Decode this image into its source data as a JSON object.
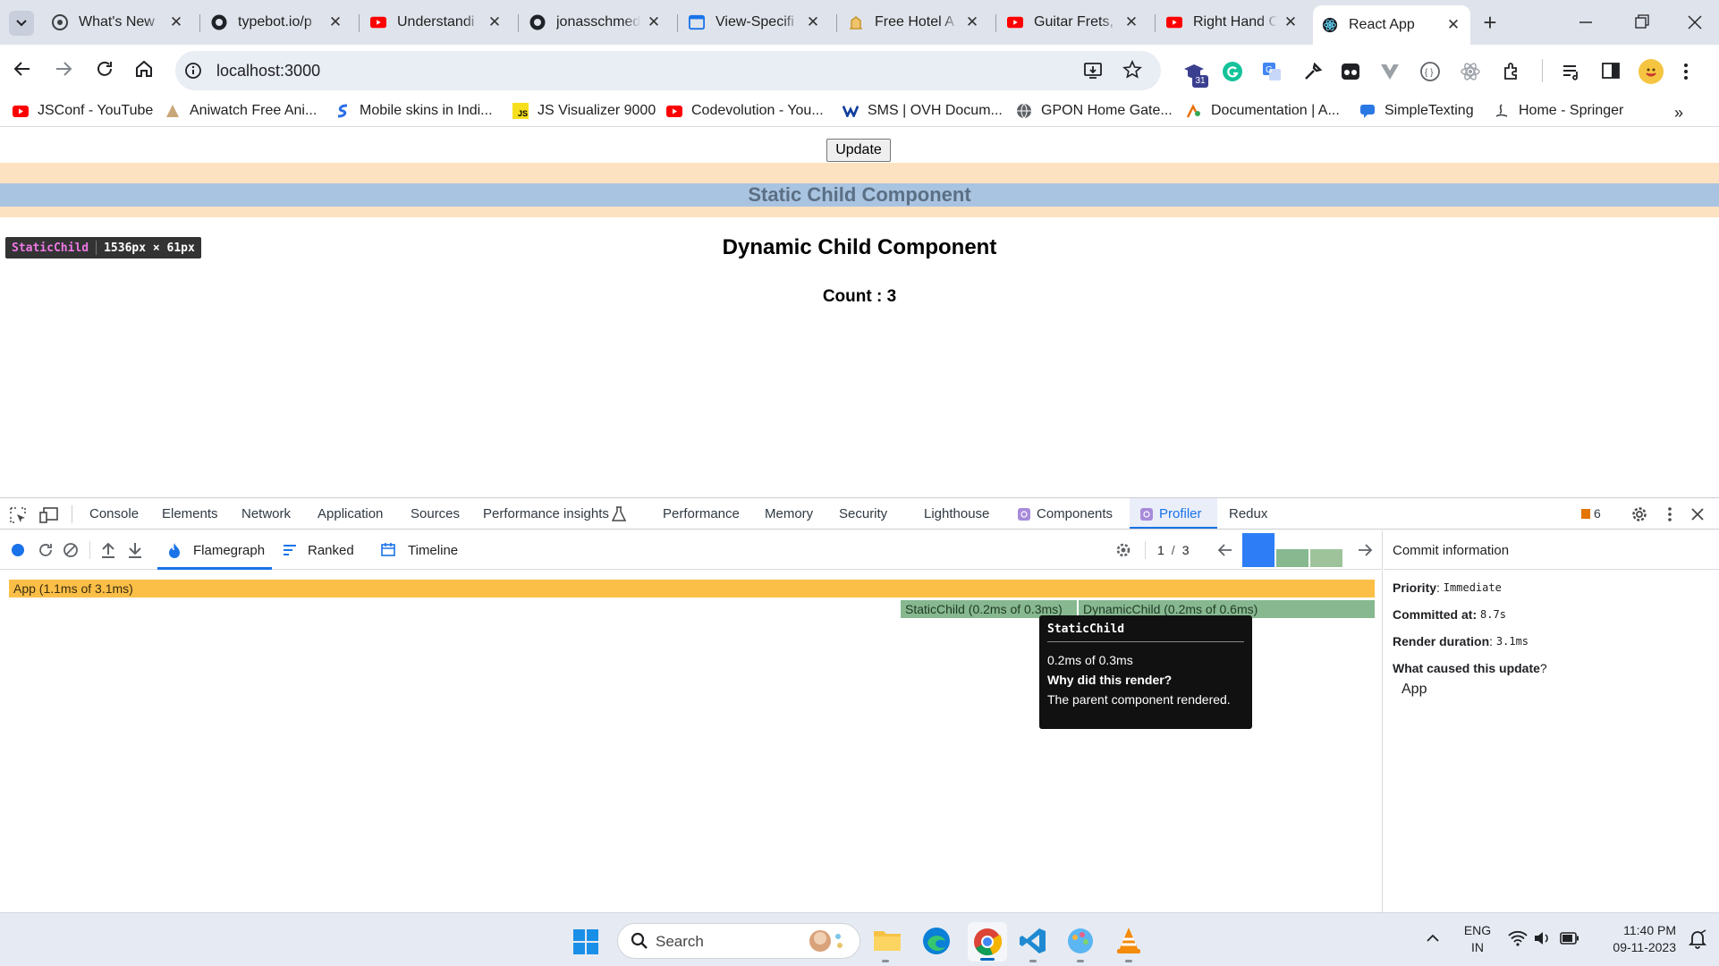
{
  "tabs": [
    {
      "title": "What's New",
      "icon": "chrome-icon"
    },
    {
      "title": "typebot.io/p",
      "icon": "github-icon"
    },
    {
      "title": "Understandi",
      "icon": "youtube-icon"
    },
    {
      "title": "jonasschmed",
      "icon": "github-icon"
    },
    {
      "title": "View-Specifi",
      "icon": "window-icon"
    },
    {
      "title": "Free Hotel A",
      "icon": "hotel-icon"
    },
    {
      "title": "Guitar Frets,",
      "icon": "youtube-icon"
    },
    {
      "title": "Right Hand C",
      "icon": "youtube-icon"
    },
    {
      "title": "React App",
      "icon": "react-icon",
      "active": true
    }
  ],
  "omnibox": {
    "url": "localhost:3000",
    "extension_badge": "31"
  },
  "bookmarks": [
    {
      "label": "JSConf - YouTube",
      "icon": "youtube-icon"
    },
    {
      "label": "Aniwatch Free Ani...",
      "icon": "anime-icon"
    },
    {
      "label": "Mobile skins in Indi...",
      "icon": "skin-icon"
    },
    {
      "label": "JS Visualizer 9000",
      "icon": "js-icon"
    },
    {
      "label": "Codevolution - You...",
      "icon": "youtube-icon"
    },
    {
      "label": "SMS | OVH Docum...",
      "icon": "ovh-icon"
    },
    {
      "label": "GPON Home Gate...",
      "icon": "globe-icon"
    },
    {
      "label": "Documentation | A...",
      "icon": "docs-icon"
    },
    {
      "label": "SimpleTexting",
      "icon": "chat-icon"
    },
    {
      "label": "Home - Springer",
      "icon": "springer-icon"
    }
  ],
  "page": {
    "update_button": "Update",
    "static_heading": "Static Child Component",
    "dynamic_heading": "Dynamic Child Component",
    "count_text": "Count : 3",
    "inspect_tag": {
      "name": "StaticChild",
      "size": "1536px × 61px"
    }
  },
  "devtools": {
    "tabs": [
      "Console",
      "Elements",
      "Network",
      "Application",
      "Sources",
      "Performance insights",
      "Performance",
      "Memory",
      "Security",
      "Lighthouse",
      "Components",
      "Profiler",
      "Redux"
    ],
    "active_tab": "Profiler",
    "issues_count": "6",
    "profiler": {
      "views": [
        "Flamegraph",
        "Ranked",
        "Timeline"
      ],
      "active_view": "Flamegraph",
      "commit_index": "1",
      "commit_total": "3",
      "commit_durations": [
        3.1,
        1.4,
        1.4
      ],
      "flame": {
        "app_label": "App (1.1ms of 3.1ms)",
        "static_label": "StaticChild (0.2ms of 0.3ms)",
        "dynamic_label": "DynamicChild (0.2ms of 0.6ms)"
      },
      "tooltip": {
        "name": "StaticChild",
        "time": "0.2ms of 0.3ms",
        "question": "Why did this render?",
        "answer": "The parent component rendered."
      },
      "commit_info": {
        "title": "Commit information",
        "priority_label": "Priority",
        "priority_value": "Immediate",
        "committed_label": "Committed at",
        "committed_value": "8.7s",
        "duration_label": "Render duration",
        "duration_value": "3.1ms",
        "cause_label": "What caused this update",
        "cause_value": "App"
      }
    }
  },
  "taskbar": {
    "search": "Search",
    "lang_top": "ENG",
    "lang_bottom": "IN",
    "time": "11:40 PM",
    "date": "09-11-2023"
  },
  "colors": {
    "app_bar": "#fbbf48",
    "child_bar": "#87b890",
    "selected_commit": "#2d7df6",
    "highlight": "#a9c4e0",
    "margin": "#fde2c1"
  }
}
